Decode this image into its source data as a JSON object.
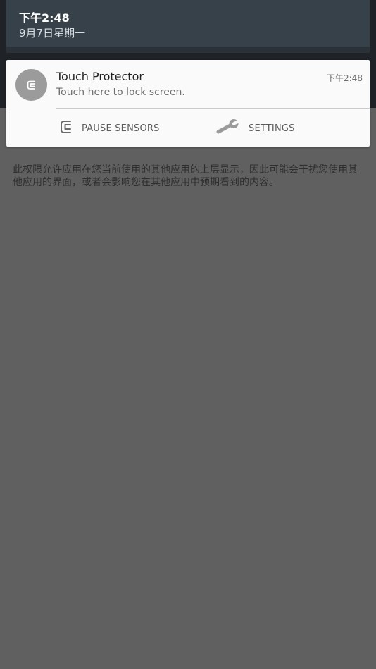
{
  "status_shade": {
    "time": "下午2:48",
    "date": "9月7日星期一"
  },
  "notification": {
    "app_icon": "touch-protector-icon",
    "title": "Touch Protector",
    "text": "Touch here to lock screen.",
    "time": "下午2:48",
    "actions": [
      {
        "label": "PAUSE SENSORS",
        "icon": "pause-sensors-icon"
      },
      {
        "label": "SETTINGS",
        "icon": "wrench-icon"
      }
    ]
  },
  "permission": {
    "description": "此权限允许应用在您当前使用的其他应用的上层显示，因此可能会干扰您使用其他应用的界面，或者会影响您在其他应用中预期看到的内容。"
  },
  "colors": {
    "background": "#606060",
    "shade": "#37414a",
    "card": "#fafafa"
  }
}
